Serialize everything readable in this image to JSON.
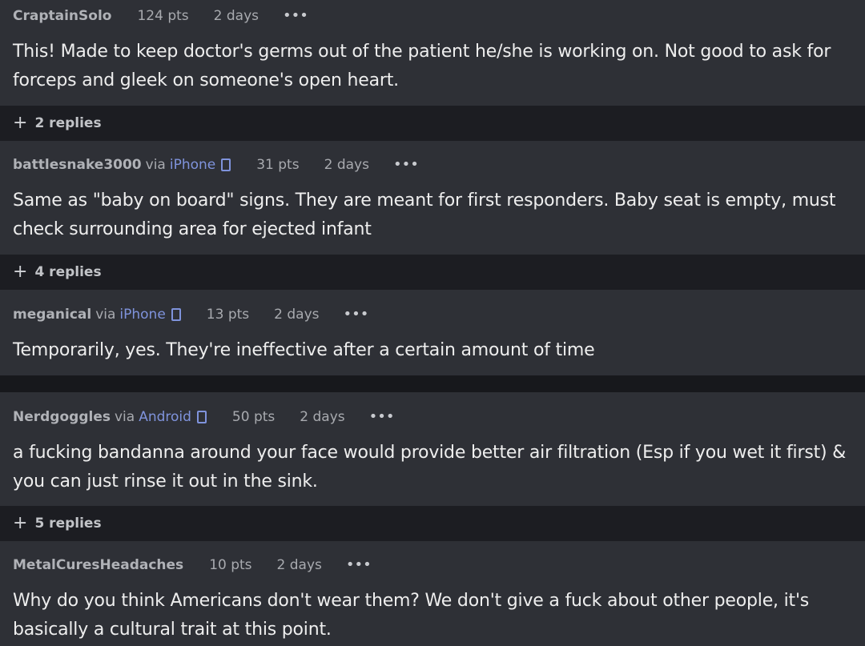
{
  "comments": [
    {
      "author": "CraptainSolo",
      "via": "",
      "device": "",
      "points": "124 pts",
      "time": "2 days",
      "more": "•••",
      "body": "This! Made to keep doctor's germs out of the patient he/she is working on. Not good to ask for forceps and gleek on someone's open heart.",
      "replies": "2 replies"
    },
    {
      "author": "battlesnake3000",
      "via": "via",
      "device": "iPhone",
      "points": "31 pts",
      "time": "2 days",
      "more": "•••",
      "body": "Same as \"baby on board\" signs. They are meant for first responders. Baby seat is empty, must check surrounding area for ejected infant",
      "replies": "4 replies"
    },
    {
      "author": "meganical",
      "via": "via",
      "device": "iPhone",
      "points": "13 pts",
      "time": "2 days",
      "more": "•••",
      "body": "Temporarily, yes. They're ineffective after a certain amount of time",
      "replies": ""
    },
    {
      "author": "Nerdgoggles",
      "via": "via",
      "device": "Android",
      "points": "50 pts",
      "time": "2 days",
      "more": "•••",
      "body": "a fucking bandanna around your face would provide better air filtration (Esp if you wet it first) & you can just rinse it out in the sink.",
      "replies": "5 replies"
    },
    {
      "author": "MetalCuresHeadaches",
      "via": "",
      "device": "",
      "points": "10 pts",
      "time": "2 days",
      "more": "•••",
      "body": "Why do you think Americans don't wear them? We don't give a fuck about other people, it's basically a cultural trait at this point.",
      "replies": ""
    }
  ],
  "icons": {
    "expand": "plus-icon",
    "device": "phone-icon",
    "more": "more-options-icon"
  },
  "colors": {
    "card_bg": "#2e3036",
    "replies_bg": "#1c1d22",
    "link": "#7f93dc",
    "text": "#eeeeee"
  }
}
